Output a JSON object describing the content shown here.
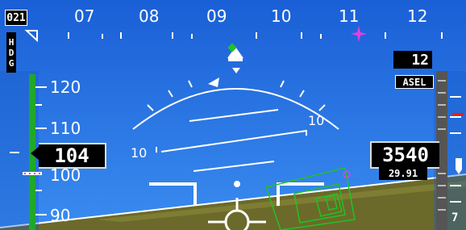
{
  "heading": {
    "bug_value": "021",
    "mode_label": "HDG",
    "mode_letters": [
      "H",
      "D",
      "G"
    ],
    "scale_labels": [
      "07",
      "08",
      "09",
      "10",
      "11",
      "12"
    ]
  },
  "airspeed": {
    "current": "104",
    "tape_labels": [
      "120",
      "110",
      "100",
      "90"
    ]
  },
  "altitude": {
    "current": "3540",
    "selected": "12",
    "selected_mode": "ASEL",
    "baro_setting": "29.91",
    "tape_label": "7"
  },
  "attitude": {
    "pitch_labels": [
      "10",
      "10"
    ]
  },
  "colors": {
    "sky": "#1d6fe0",
    "ground": "#6b6a2a",
    "speed_band": "#1fa82a",
    "magenta_bug": "#e040e0",
    "fpm_green": "#22c222"
  }
}
